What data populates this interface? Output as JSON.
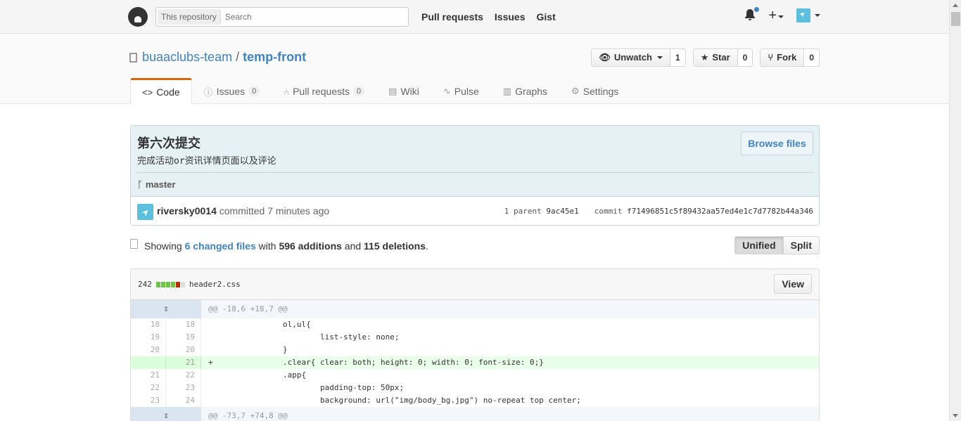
{
  "header": {
    "search_scope": "This repository",
    "search_placeholder": "Search",
    "nav": [
      "Pull requests",
      "Issues",
      "Gist"
    ]
  },
  "repo": {
    "owner": "buaaclubs-team",
    "separator": "/",
    "name": "temp-front",
    "watch_label": "Unwatch",
    "watch_count": "1",
    "star_label": "Star",
    "star_count": "0",
    "fork_label": "Fork",
    "fork_count": "0",
    "tabs": [
      {
        "label": "Code",
        "count": null
      },
      {
        "label": "Issues",
        "count": "0"
      },
      {
        "label": "Pull requests",
        "count": "0"
      },
      {
        "label": "Wiki",
        "count": null
      },
      {
        "label": "Pulse",
        "count": null
      },
      {
        "label": "Graphs",
        "count": null
      },
      {
        "label": "Settings",
        "count": null
      }
    ]
  },
  "commit": {
    "title": "第六次提交",
    "description": "完成活动or资讯详情页面以及评论",
    "browse_label": "Browse files",
    "branch": "master",
    "author": "riversky0014",
    "committed_text": "committed 7 minutes ago",
    "parent_label": "1 parent",
    "parent_sha": "9ac45e1",
    "commit_label": "commit",
    "commit_sha": "f71496851c5f89432aa57ed4e1c7d7782b44a346"
  },
  "toc": {
    "showing": "Showing",
    "changed_files": "6 changed files",
    "with": "with",
    "additions": "596 additions",
    "and": "and",
    "deletions": "115 deletions",
    "period": ".",
    "unified_label": "Unified",
    "split_label": "Split"
  },
  "file": {
    "changes": "242",
    "name": "header2.css",
    "view_label": "View",
    "diffstat": [
      "a",
      "a",
      "a",
      "a",
      "d",
      "n"
    ],
    "hunks": [
      "@@ -18,6 +18,7 @@",
      "@@ -73,7 +74,8 @@"
    ],
    "lines": [
      {
        "old": "18",
        "new": "18",
        "type": "ctx",
        "text": "\t\tol,ul{"
      },
      {
        "old": "19",
        "new": "19",
        "type": "ctx",
        "text": "\t\t\tlist-style: none;"
      },
      {
        "old": "20",
        "new": "20",
        "type": "ctx",
        "text": "\t\t}"
      },
      {
        "old": "",
        "new": "21",
        "type": "add",
        "text": "+\t\t.clear{ clear: both; height: 0; width: 0; font-size: 0;}"
      },
      {
        "old": "21",
        "new": "22",
        "type": "ctx",
        "text": "\t\t.app{"
      },
      {
        "old": "22",
        "new": "23",
        "type": "ctx",
        "text": "\t\t\tpadding-top: 50px;"
      },
      {
        "old": "23",
        "new": "24",
        "type": "ctx",
        "text": "\t\t\tbackground: url(\"img/body_bg.jpg\") no-repeat top center;"
      }
    ]
  },
  "colors": {
    "link": "#4183c4",
    "addition": "#6cc644",
    "deletion": "#bd2c00",
    "selected_tab": "#d26911"
  }
}
